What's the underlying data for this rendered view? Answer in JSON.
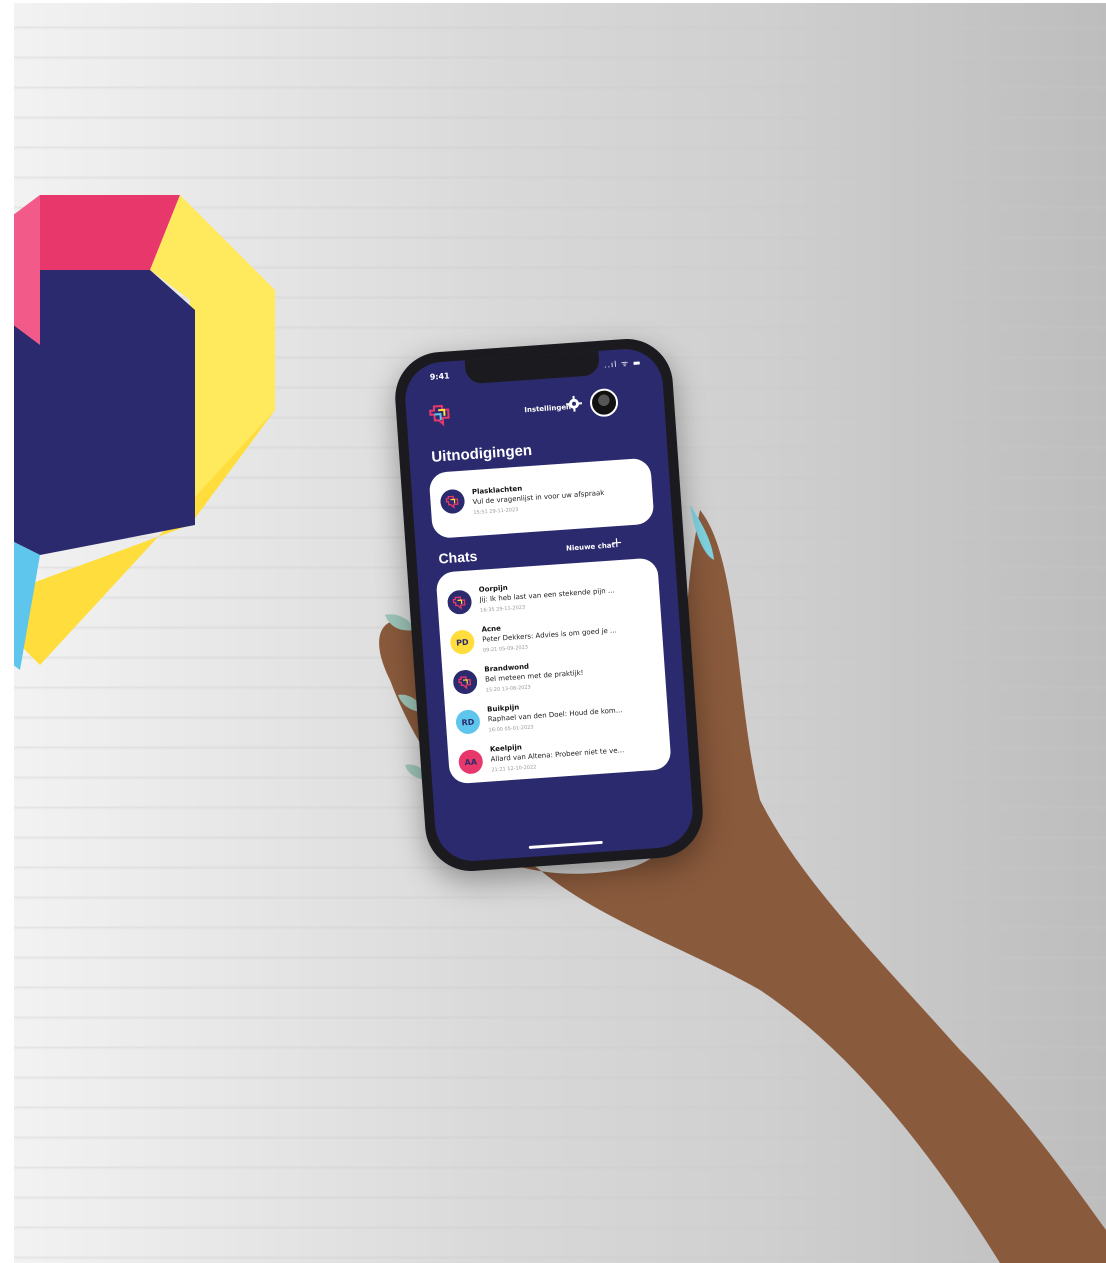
{
  "colors": {
    "brand_navy": "#2b2a6e",
    "brand_pink": "#e8386b",
    "brand_yellow": "#ffdd3c",
    "brand_blue": "#5ec6ec",
    "card_bg": "#ffffff"
  },
  "status_bar": {
    "time": "9:41",
    "icons": "..ıl ᯤ ▬"
  },
  "header": {
    "settings_label": "Instellingen",
    "gear_icon": "gear-icon",
    "logo_icon": "app-logo-icon"
  },
  "invitations": {
    "title": "Uitnodigingen",
    "items": [
      {
        "title": "Plasklachten",
        "message": "Vul de vragenlijst in voor uw afspraak",
        "time": "15:51 29-11-2023",
        "avatar": "logo"
      }
    ]
  },
  "chats": {
    "title": "Chats",
    "new_chat_label": "Nieuwe chat",
    "plus_icon": "+",
    "items": [
      {
        "title": "Oorpijn",
        "message": "Jij: Ik heb last van een stekende pijn ...",
        "time": "16:35 29-11-2023",
        "avatar": "logo",
        "avatar_color": "#2b2a6e"
      },
      {
        "title": "Acne",
        "message": "Peter Dekkers: Advies is om goed je ...",
        "time": "09:21 05-09-2023",
        "avatar": "PD",
        "avatar_color": "#ffdd3c"
      },
      {
        "title": "Brandwond",
        "message": "Bel meteen met de praktijk!",
        "time": "15:20 13-08-2023",
        "avatar": "logo",
        "avatar_color": "#2b2a6e"
      },
      {
        "title": "Buikpijn",
        "message": "Raphael van den Doel: Houd de kom...",
        "time": "16:00 05-01-2023",
        "avatar": "RD",
        "avatar_color": "#5ec6ec"
      },
      {
        "title": "Keelpijn",
        "message": "Allard van Altena: Probeer niet te ve...",
        "time": "21:21 12-10-2022",
        "avatar": "AA",
        "avatar_color": "#e8386b"
      }
    ]
  }
}
